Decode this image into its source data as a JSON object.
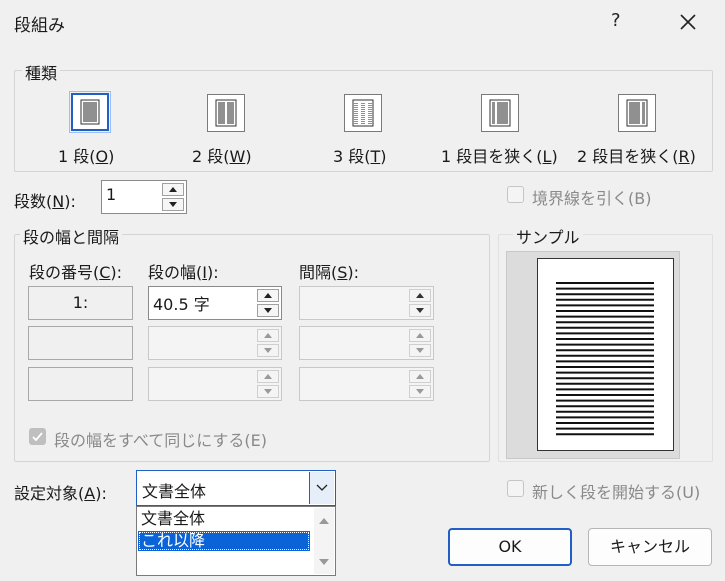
{
  "window": {
    "title": "段組み",
    "help_label": "?",
    "close_icon": "close-icon"
  },
  "presets": {
    "group_label": "種類",
    "items": [
      {
        "label_pre": "1 段(",
        "key": "O",
        "label_post": ")",
        "selected": true
      },
      {
        "label_pre": "2 段(",
        "key": "W",
        "label_post": ")",
        "selected": false
      },
      {
        "label_pre": "3 段(",
        "key": "T",
        "label_post": ")",
        "selected": false
      },
      {
        "label_pre": "1 段目を狭く(",
        "key": "L",
        "label_post": ")",
        "selected": false
      },
      {
        "label_pre": "2 段目を狭く(",
        "key": "R",
        "label_post": ")",
        "selected": false
      }
    ]
  },
  "columns_count": {
    "label_pre": "段数(",
    "key": "N",
    "label_post": "):",
    "value": "1"
  },
  "line_between": {
    "label": "境界線を引く(B)",
    "checked": false,
    "enabled": false
  },
  "width_spacing": {
    "group_label": "段の幅と間隔",
    "headers": {
      "col": {
        "pre": "段の番号(",
        "key": "C",
        "post": "):"
      },
      "width": {
        "pre": "段の幅(",
        "key": "I",
        "post": "):"
      },
      "spacing": {
        "pre": "間隔(",
        "key": "S",
        "post": "):"
      }
    },
    "rows": [
      {
        "col": "1:",
        "width": "40.5 字",
        "spacing": ""
      },
      {
        "col": "",
        "width": "",
        "spacing": ""
      },
      {
        "col": "",
        "width": "",
        "spacing": ""
      }
    ],
    "equal_width": {
      "label": "段の幅をすべて同じにする(E)",
      "checked": true,
      "enabled": false
    }
  },
  "sample": {
    "group_label": "サンプル",
    "line_count": 28
  },
  "apply_to": {
    "label_pre": "設定対象(",
    "key": "A",
    "label_post": "):",
    "value": "文書全体",
    "options": [
      "文書全体",
      "これ以降"
    ],
    "highlighted_index": 1
  },
  "new_column": {
    "label": "新しく段を開始する(U)",
    "checked": false,
    "enabled": false
  },
  "buttons": {
    "ok": "OK",
    "cancel": "キャンセル"
  },
  "colors": {
    "accent": "#1f5fc6",
    "highlight": "#0a64d8",
    "background": "#f0f0f0"
  }
}
